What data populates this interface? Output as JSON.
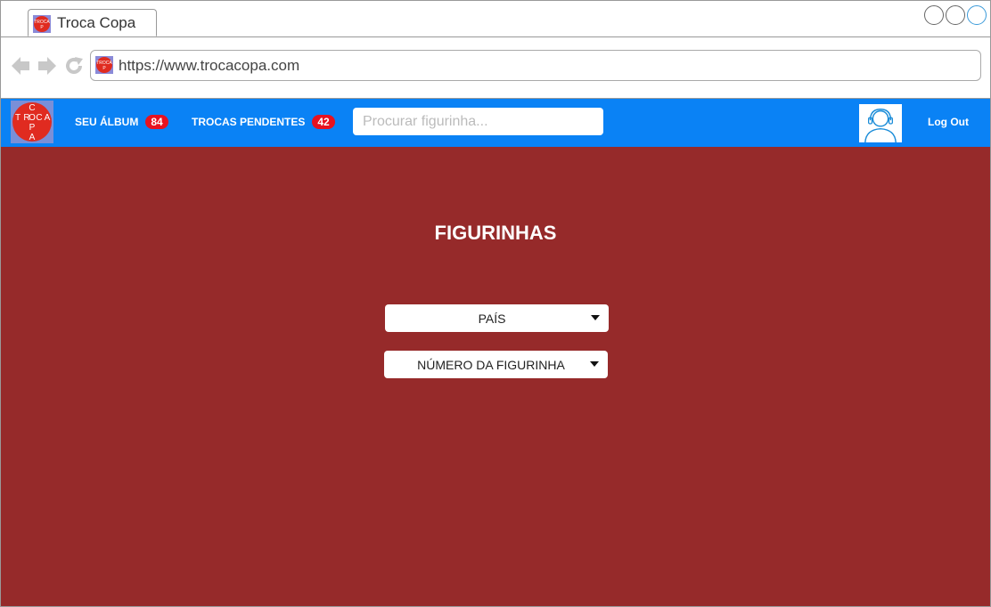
{
  "browser": {
    "tab_title": "Troca Copa",
    "url": "https://www.trocacopa.com"
  },
  "navbar": {
    "logo_letters": [
      "C",
      "T",
      "R",
      "O",
      "C",
      "A",
      "P",
      "A"
    ],
    "links": [
      {
        "label": "SEU ÁLBUM",
        "badge": "84"
      },
      {
        "label": "TROCAS PENDENTES",
        "badge": "42"
      }
    ],
    "search_placeholder": "Procurar figurinha...",
    "logout_label": "Log Out"
  },
  "main": {
    "title": "FIGURINHAS",
    "filters": [
      {
        "label": "PAÍS"
      },
      {
        "label": "NÚMERO DA FIGURINHA"
      }
    ]
  },
  "colors": {
    "navbar": "#0a82f5",
    "main_background": "#962a2a",
    "badge": "#e8121f",
    "logo_background": "#e02b20"
  }
}
